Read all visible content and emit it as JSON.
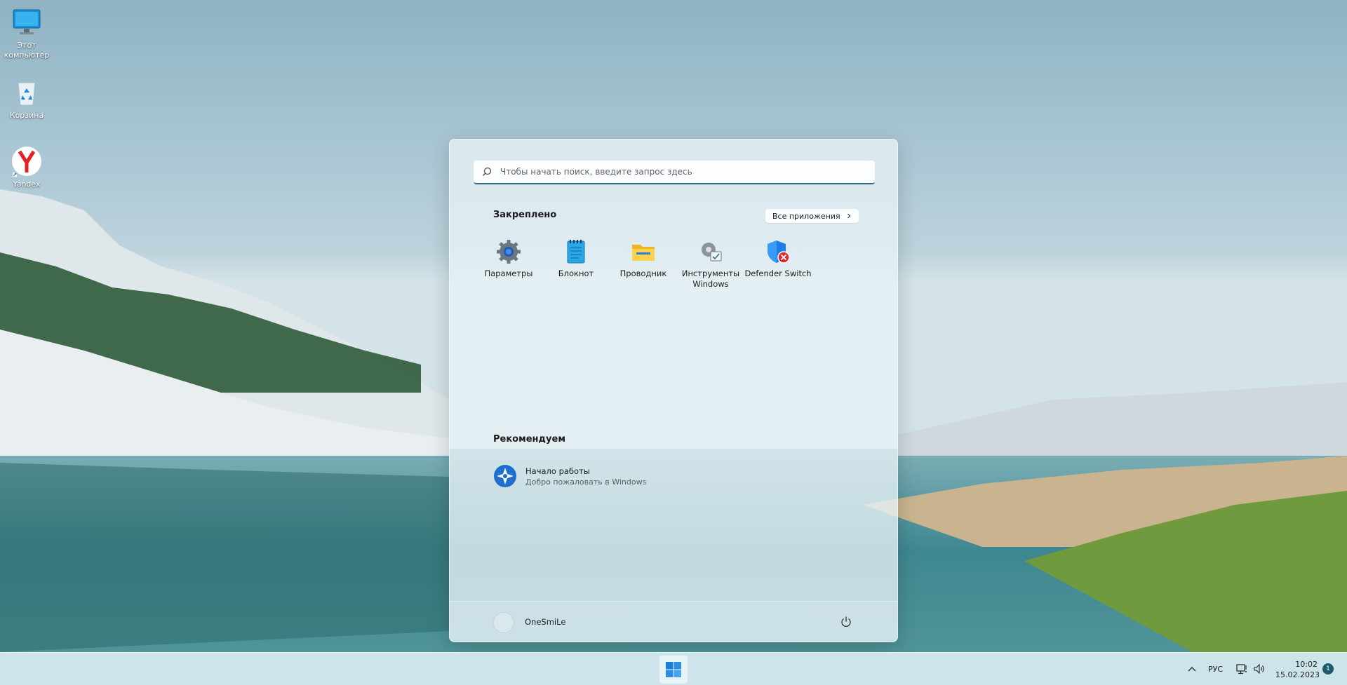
{
  "desktop": {
    "icons": [
      {
        "label": "Этот компьютер",
        "icon": "monitor-icon"
      },
      {
        "label": "Корзина",
        "icon": "recycle-bin-icon"
      },
      {
        "label": "Yandex",
        "icon": "yandex-browser-icon"
      }
    ]
  },
  "start_menu": {
    "search": {
      "placeholder": "Чтобы начать поиск, введите запрос здесь",
      "value": ""
    },
    "pinned_title": "Закреплено",
    "all_apps_label": "Все приложения",
    "pinned": [
      {
        "label": "Параметры",
        "icon": "settings-gear-icon"
      },
      {
        "label": "Блокнот",
        "icon": "notepad-icon"
      },
      {
        "label": "Проводник",
        "icon": "file-explorer-folder-icon"
      },
      {
        "label": "Инструменты Windows",
        "icon": "windows-tools-icon"
      },
      {
        "label": "Defender Switch",
        "icon": "defender-switch-shield-icon"
      }
    ],
    "recommended_title": "Рекомендуем",
    "recommended": [
      {
        "title": "Начало работы",
        "subtitle": "Добро пожаловать в Windows",
        "icon": "get-started-icon"
      }
    ],
    "user": {
      "name": "OneSmiLe"
    },
    "power_icon": "power-icon"
  },
  "taskbar": {
    "start_icon": "windows-logo-icon",
    "tray": {
      "chevron_icon": "chevron-up-icon",
      "language": "РУС",
      "network_icon": "network-icon",
      "volume_icon": "volume-icon",
      "time": "10:02",
      "date": "15.02.2023",
      "notifications_count": "1"
    }
  },
  "colors": {
    "accent": "#2f6f80",
    "taskbar_bg": "#d6eaf0",
    "start_bg": "#e8f2f6"
  }
}
